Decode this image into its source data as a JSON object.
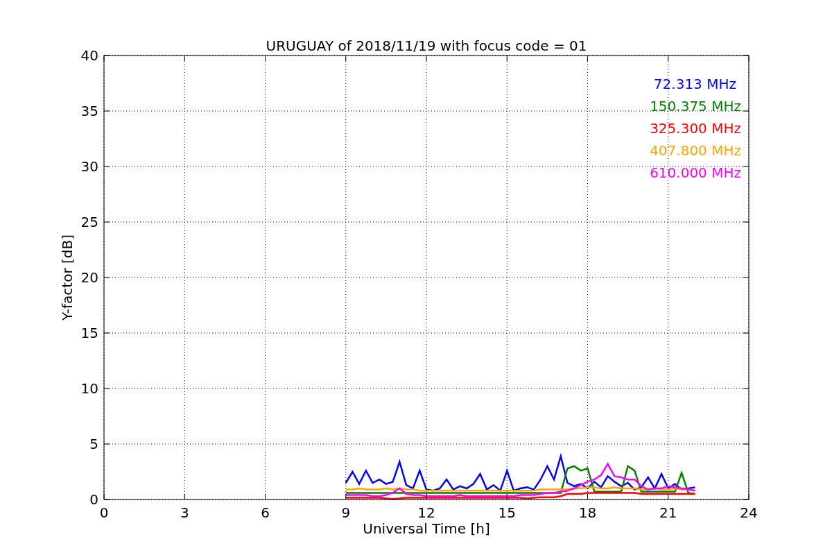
{
  "chart_data": {
    "type": "line",
    "title": "URUGUAY of 2018/11/19 with focus code = 01",
    "xlabel": "Universal Time [h]",
    "ylabel": "Y-factor [dB]",
    "grid": true,
    "xlim": [
      0,
      24
    ],
    "ylim": [
      0,
      40
    ],
    "xticks": [
      0,
      3,
      6,
      9,
      12,
      15,
      18,
      21,
      24
    ],
    "yticks": [
      0,
      5,
      10,
      15,
      20,
      25,
      30,
      35,
      40
    ],
    "x": [
      9,
      9.25,
      9.5,
      9.75,
      10,
      10.25,
      10.5,
      10.75,
      11,
      11.25,
      11.5,
      11.75,
      12,
      12.25,
      12.5,
      12.75,
      13,
      13.25,
      13.5,
      13.75,
      14,
      14.25,
      14.5,
      14.75,
      15,
      15.25,
      15.5,
      15.75,
      16,
      16.25,
      16.5,
      16.75,
      17,
      17.25,
      17.5,
      17.75,
      18,
      18.25,
      18.5,
      18.75,
      19,
      19.25,
      19.5,
      19.75,
      20,
      20.25,
      20.5,
      20.75,
      21,
      21.25,
      21.5,
      21.75,
      22
    ],
    "series": [
      {
        "name": "72.313 MHz",
        "color": "#0000ff",
        "values": [
          1.5,
          2.5,
          1.4,
          2.6,
          1.5,
          1.8,
          1.4,
          1.6,
          3.4,
          1.3,
          1.0,
          2.6,
          0.9,
          0.8,
          1.0,
          1.8,
          0.9,
          1.2,
          1.0,
          1.4,
          2.3,
          0.9,
          1.3,
          0.8,
          2.6,
          0.8,
          1.0,
          1.1,
          0.9,
          1.8,
          3.0,
          1.8,
          3.9,
          1.5,
          1.2,
          1.4,
          1.0,
          1.6,
          1.1,
          2.1,
          1.6,
          1.2,
          1.5,
          0.9,
          1.1,
          2.0,
          1.0,
          2.3,
          1.0,
          1.4,
          0.9,
          1.0,
          1.1
        ]
      },
      {
        "name": "150.375 MHz",
        "color": "#008000",
        "values": [
          0.6,
          0.6,
          0.6,
          0.6,
          0.6,
          0.6,
          0.6,
          0.6,
          0.6,
          0.6,
          0.6,
          0.6,
          0.6,
          0.6,
          0.6,
          0.6,
          0.6,
          0.6,
          0.6,
          0.6,
          0.6,
          0.6,
          0.6,
          0.6,
          0.6,
          0.6,
          0.6,
          0.6,
          0.6,
          0.6,
          0.6,
          0.6,
          0.6,
          2.8,
          3.0,
          2.6,
          2.8,
          0.7,
          0.7,
          0.7,
          0.7,
          0.7,
          3.0,
          2.6,
          0.7,
          0.7,
          0.7,
          0.7,
          0.7,
          0.7,
          2.4,
          0.6,
          0.5
        ]
      },
      {
        "name": "325.300 MHz",
        "color": "#ff0000",
        "values": [
          0.15,
          0.15,
          0.15,
          0.15,
          0.15,
          0.15,
          0.1,
          0.05,
          0.1,
          0.15,
          0.15,
          0.15,
          0.15,
          0.15,
          0.15,
          0.15,
          0.15,
          0.15,
          0.15,
          0.15,
          0.15,
          0.15,
          0.15,
          0.15,
          0.15,
          0.15,
          0.15,
          0.1,
          0.15,
          0.2,
          0.2,
          0.2,
          0.3,
          0.5,
          0.5,
          0.5,
          0.6,
          0.6,
          0.6,
          0.6,
          0.6,
          0.6,
          0.6,
          0.6,
          0.5,
          0.5,
          0.5,
          0.5,
          0.5,
          0.5,
          0.5,
          0.5,
          0.5
        ]
      },
      {
        "name": "407.800 MHz",
        "color": "#ffa500",
        "values": [
          0.9,
          0.9,
          1.0,
          0.9,
          0.9,
          0.9,
          1.0,
          0.9,
          1.0,
          0.9,
          0.9,
          0.8,
          0.8,
          0.8,
          0.8,
          0.8,
          0.8,
          0.8,
          0.8,
          0.8,
          0.8,
          0.8,
          0.8,
          0.8,
          0.8,
          0.8,
          0.8,
          0.8,
          0.8,
          0.9,
          0.9,
          0.9,
          0.9,
          0.9,
          1.0,
          1.0,
          1.1,
          1.1,
          1.0,
          1.0,
          1.1,
          1.0,
          1.0,
          1.0,
          0.9,
          0.9,
          1.0,
          0.9,
          0.9,
          1.0,
          0.9,
          0.9,
          0.8
        ]
      },
      {
        "name": "610.000 MHz",
        "color": "#ff00ff",
        "values": [
          0.4,
          0.4,
          0.4,
          0.4,
          0.3,
          0.3,
          0.4,
          0.6,
          1.0,
          0.5,
          0.4,
          0.4,
          0.3,
          0.3,
          0.3,
          0.3,
          0.3,
          0.4,
          0.3,
          0.3,
          0.3,
          0.3,
          0.3,
          0.3,
          0.3,
          0.3,
          0.4,
          0.4,
          0.4,
          0.5,
          0.6,
          0.6,
          0.7,
          0.8,
          1.0,
          1.3,
          1.6,
          1.8,
          2.2,
          3.2,
          2.1,
          2.0,
          1.8,
          1.8,
          1.2,
          0.9,
          1.0,
          1.0,
          1.2,
          1.1,
          1.0,
          0.9,
          0.8
        ]
      }
    ]
  }
}
